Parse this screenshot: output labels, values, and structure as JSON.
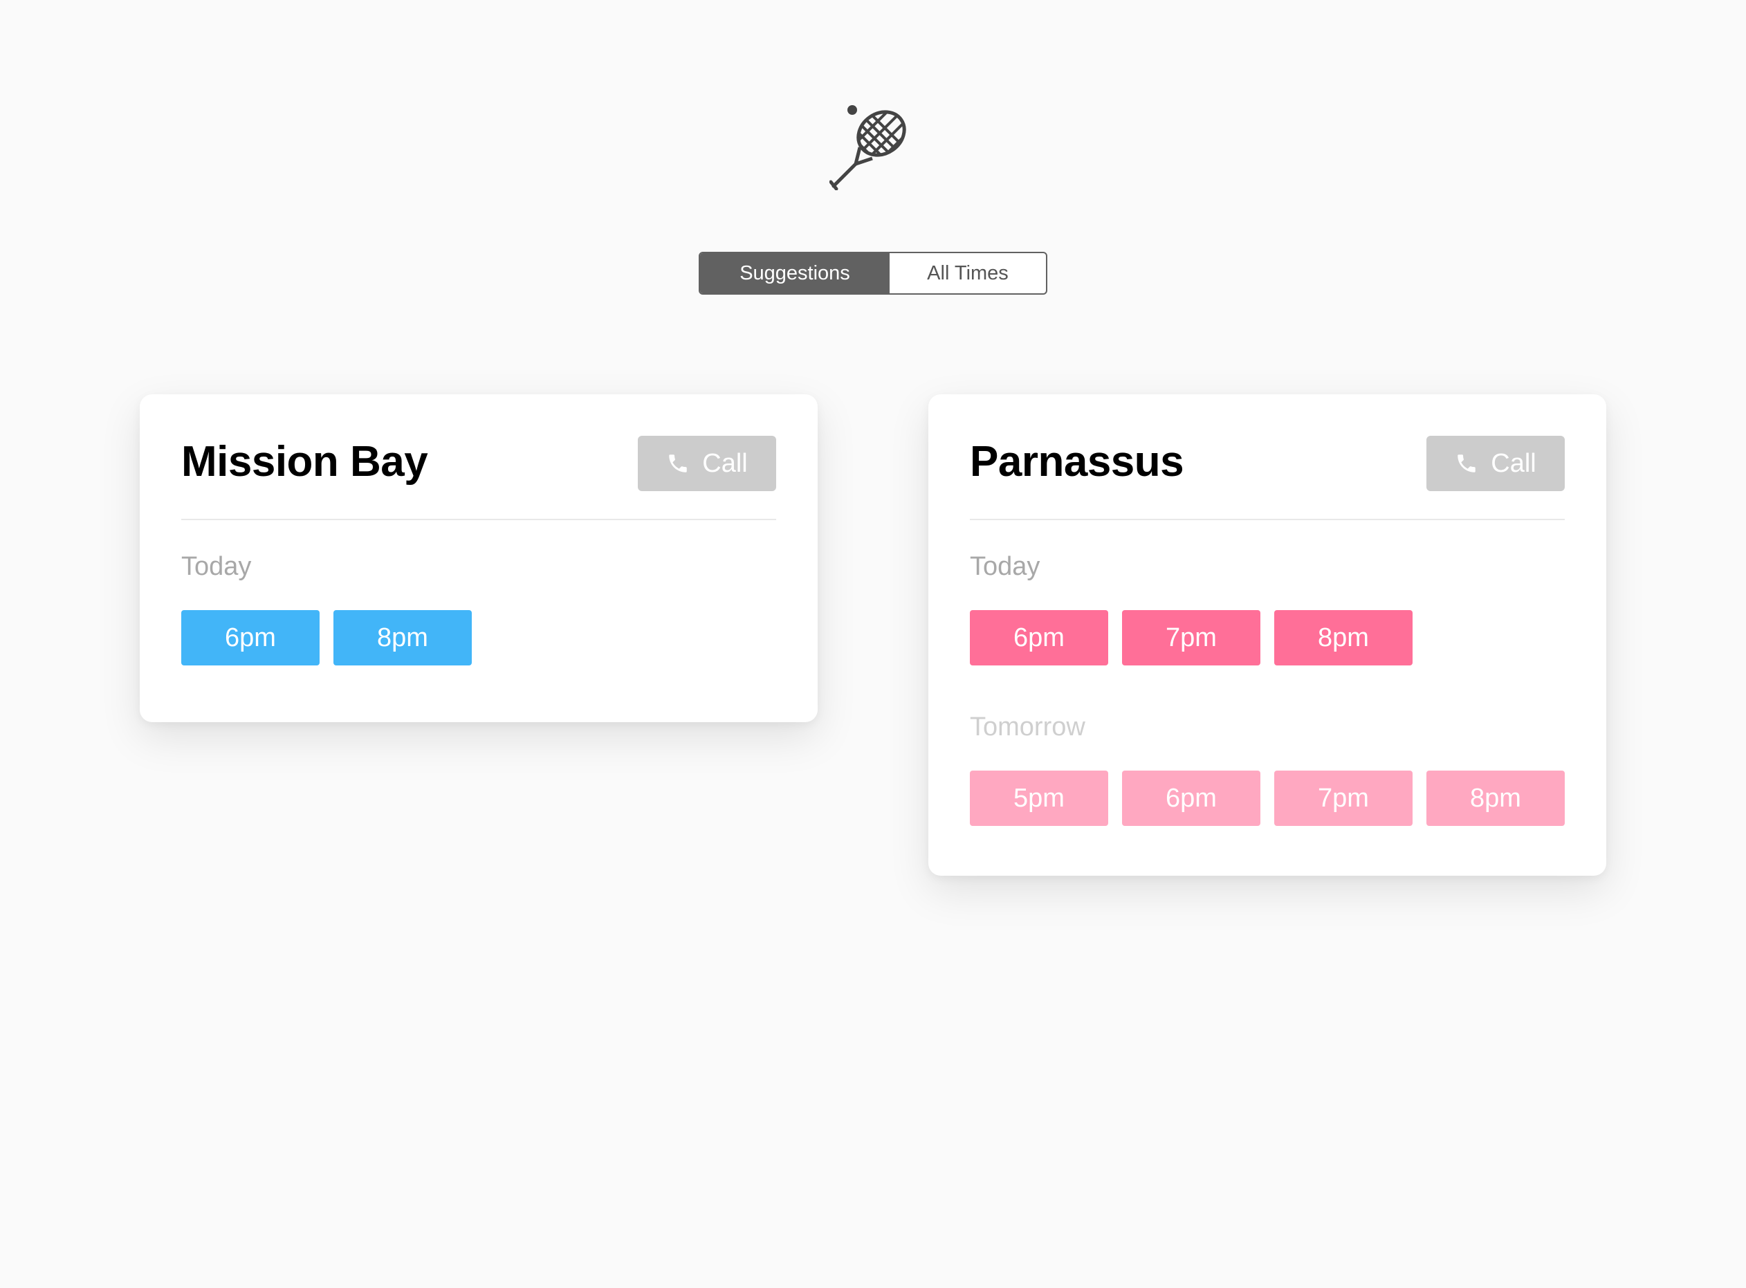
{
  "logo": {
    "icon": "tennis-racket-icon",
    "color": "#444444"
  },
  "tabs": [
    {
      "label": "Suggestions",
      "active": true
    },
    {
      "label": "All Times",
      "active": false
    }
  ],
  "locations": [
    {
      "name": "Mission Bay",
      "call_label": "Call",
      "call_icon": "phone-icon",
      "today_label": "Today",
      "today_slots": [
        "6pm",
        "8pm"
      ],
      "today_color": "#42b5f8"
    },
    {
      "name": "Parnassus",
      "call_label": "Call",
      "call_icon": "phone-icon",
      "today_label": "Today",
      "today_slots": [
        "6pm",
        "7pm",
        "8pm"
      ],
      "today_color": "#ff6f98",
      "tomorrow_label": "Tomorrow",
      "tomorrow_slots": [
        "5pm",
        "6pm",
        "7pm",
        "8pm"
      ],
      "tomorrow_color": "#ffa8c1"
    }
  ],
  "colors": {
    "background": "#fafafa",
    "segment_active": "#616161",
    "call_button": "#cccccc"
  }
}
